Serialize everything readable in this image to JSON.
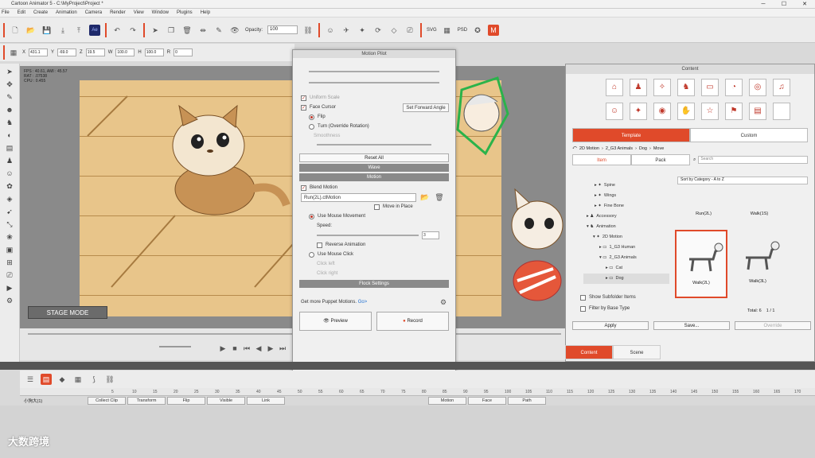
{
  "window": {
    "title": "Cartoon Animator 5 - C:\\MyProject\\Project *"
  },
  "menu": [
    "File",
    "Edit",
    "Create",
    "Animation",
    "Camera",
    "Render",
    "View",
    "Window",
    "Plugins",
    "Help"
  ],
  "toolbar": {
    "opacity_label": "Opacity:",
    "opacity_value": "100",
    "svg_label": "SVG",
    "psd_label": "PSD"
  },
  "transform": {
    "x_label": "X",
    "x": "431.1",
    "y_label": "Y",
    "y": "-69.0",
    "z_label": "Z",
    "z": "19.5",
    "w_label": "W",
    "w": "100.0",
    "h_label": "H",
    "h": "100.0",
    "r_label": "R",
    "r": "0"
  },
  "stage": {
    "label": "STAGE MODE",
    "fps": "FPS : 40.61, AMI : 45.57",
    "rat": "RAT : .07538",
    "cpu": "CPU : 0.455"
  },
  "motion_pilot": {
    "title": "Motion Pilot",
    "unify_scale": "Uniform Scale",
    "face_cursor": "Face Cursor",
    "set_forward": "Set Forward Angle",
    "flip": "Flip",
    "turn": "Turn (Override Rotation)",
    "smoothness": "Smoothness",
    "reset": "Reset All",
    "wave": "Wave",
    "motion": "Motion",
    "blend_motion": "Blend Motion",
    "motion_file": "Run(2L).ctMotion",
    "move_in_place": "Move in Place",
    "use_mouse_movement": "Use Mouse Movement",
    "speed_label": "Speed:",
    "speed_value": "3",
    "reverse": "Reverse Animation",
    "use_mouse_click": "Use Mouse Click",
    "click_left": "Click left",
    "click_right": "Click right",
    "flock": "Flock Settings",
    "get_more": "Get more Puppet Motions.",
    "get_more_link": "Go>",
    "preview": "Preview",
    "record": "Record"
  },
  "content_panel": {
    "title": "Content",
    "tab_template": "Template",
    "tab_custom": "Custom",
    "breadcrumb": [
      "2D Motion",
      "2_G3 Animals",
      "Dog",
      "Move"
    ],
    "subtab_item": "Item",
    "subtab_pack": "Pack",
    "search_placeholder": "Search",
    "sort": "Sort by Category - A to Z",
    "tree": [
      "Spine",
      "Wings",
      "Fine Bone",
      "Accessory",
      "Animation",
      "2D Motion",
      "1_G3 Human",
      "2_G3 Animals",
      "Cat",
      "Dog"
    ],
    "items": [
      "Run(2L)",
      "Walk(1S)",
      "Walk(2L)",
      "Walk(3L)"
    ],
    "show_subfolder": "Show Subfolder Items",
    "filter_base": "Filter by Base Type",
    "total": "Total: 6",
    "page": "1 / 1",
    "apply": "Apply",
    "save": "Save...",
    "override": "Override"
  },
  "bottom_tabs": {
    "content": "Content",
    "scene": "Scene"
  },
  "timeline": {
    "track_name": "小狗大(1)",
    "ruler": [
      "5",
      "10",
      "15",
      "20",
      "25",
      "30",
      "35",
      "40",
      "45",
      "50",
      "55",
      "60",
      "65",
      "70",
      "75",
      "80",
      "85",
      "90",
      "95",
      "100",
      "105",
      "110",
      "115",
      "120",
      "125",
      "130",
      "135",
      "140",
      "145",
      "150",
      "155",
      "160",
      "165",
      "170"
    ],
    "cells": [
      "Collect Clip",
      "Transform",
      "Flip",
      "Visible",
      "Link",
      "Motion",
      "Face",
      "Path"
    ]
  },
  "watermark": "大数跨境"
}
